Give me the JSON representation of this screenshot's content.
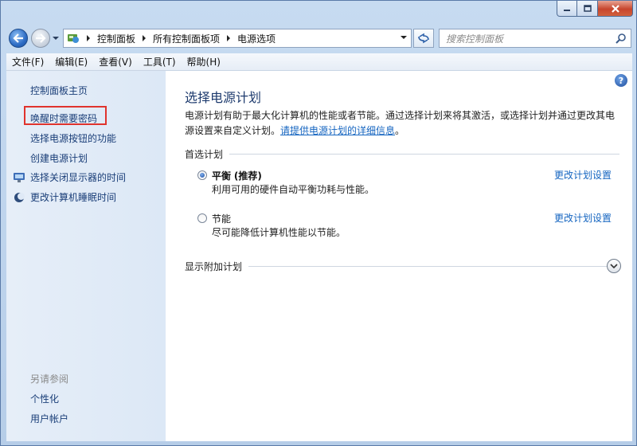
{
  "window": {
    "caption_buttons": [
      "minimize",
      "maximize",
      "close"
    ]
  },
  "address_bar": {
    "crumbs": [
      "控制面板",
      "所有控制面板项",
      "电源选项"
    ]
  },
  "search": {
    "placeholder": "搜索控制面板"
  },
  "menu": [
    "文件(F)",
    "编辑(E)",
    "查看(V)",
    "工具(T)",
    "帮助(H)"
  ],
  "sidebar": {
    "home": "控制面板主页",
    "tasks": [
      {
        "label": "唤醒时需要密码",
        "highlighted": true
      },
      {
        "label": "选择电源按钮的功能"
      },
      {
        "label": "创建电源计划"
      },
      {
        "label": "选择关闭显示器的时间",
        "icon": "monitor-icon"
      },
      {
        "label": "更改计算机睡眠时间",
        "icon": "moon-icon"
      }
    ],
    "see_also_heading": "另请参阅",
    "see_also": [
      "个性化",
      "用户帐户"
    ]
  },
  "main": {
    "title": "选择电源计划",
    "desc_part1": "电源计划有助于最大化计算机的性能或者节能。通过选择计划来将其激活，或选择计划并通过更改其电源设置来自定义计划。",
    "desc_link": "请提供电源计划的详细信息",
    "desc_part2": "。",
    "preferred_label": "首选计划",
    "plans": [
      {
        "name": "平衡",
        "suffix": "(推荐)",
        "desc": "利用可用的硬件自动平衡功耗与性能。",
        "selected": true,
        "link": "更改计划设置"
      },
      {
        "name": "节能",
        "suffix": "",
        "desc": "尽可能降低计算机性能以节能。",
        "selected": false,
        "link": "更改计划设置"
      }
    ],
    "more_plans_label": "显示附加计划"
  },
  "colors": {
    "link": "#1565c0",
    "sidebar_link": "#1a3e78",
    "highlight": "#e0332d",
    "title": "#1e3b6e"
  }
}
